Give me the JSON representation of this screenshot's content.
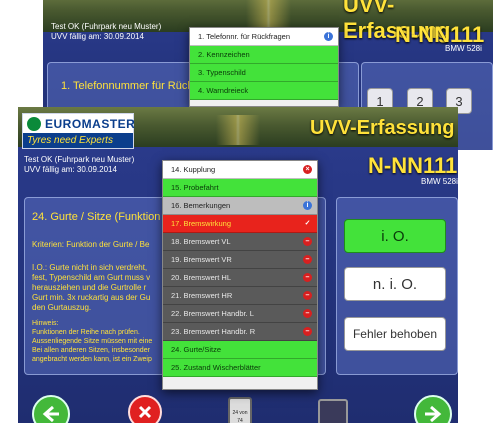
{
  "back_screen": {
    "brand_name": "EUROMASTER",
    "slogan": "Tyres need Experts",
    "app_title": "UVV-Erfassung",
    "test_name": "Test OK (Fuhrpark neu Muster)",
    "due": "UVV fällig am: 30.09.2014",
    "plate": "N-NN111",
    "car_model": "BMW 528i",
    "question": "1. Telefonnummer für Rück",
    "keypad": [
      "1",
      "2",
      "3"
    ],
    "dropdown": [
      {
        "label": "1. Telefonnr. für Rückfragen",
        "style": "white",
        "icon": "i"
      },
      {
        "label": "2. Kennzeichen",
        "style": "green",
        "icon": ""
      },
      {
        "label": "3. Typenschild",
        "style": "green",
        "icon": ""
      },
      {
        "label": "4. Warndreieck",
        "style": "green",
        "icon": ""
      }
    ]
  },
  "front_screen": {
    "brand_name": "EUROMASTER",
    "slogan": "Tyres need Experts",
    "app_title": "UVV-Erfassung",
    "test_name": "Test OK (Fuhrpark neu Muster)",
    "due": "UVV fällig am: 30.09.2014",
    "plate": "N-NN111",
    "car_model": "BMW 528i",
    "question": "24. Gurte / Sitze (Funktion",
    "criteria": "Kriterien: Funktion der Gurte / Be",
    "io_text": "I.O.: Gurte nicht in sich verdreht, \nfest, Typenschild am Gurt muss v\nherausziehen und die Gurtrolle r\nGurt min. 3x ruckartig aus der Gu\nden Gurtauszug.",
    "hint_text": "Hinweis:\nFunktionen der Reihe nach prüfen.\nAussenliegende Sitze müssen mit eine\nBei allen anderen Sitzen, insbesonder\nangebracht werden kann, ist ein Zweip",
    "btn_io": "i. O.",
    "btn_nio": "n. i. O.",
    "btn_fixed": "Fehler behoben",
    "dropdown": [
      {
        "label": "14. Kupplung",
        "style": "white",
        "icon": "x"
      },
      {
        "label": "15. Probefahrt",
        "style": "green",
        "icon": ""
      },
      {
        "label": "16. Bemerkungen",
        "style": "gray",
        "icon": "i"
      },
      {
        "label": "17. Bremswirkung",
        "style": "red",
        "icon": "check"
      },
      {
        "label": "18. Bremswert VL",
        "style": "dark",
        "icon": "-"
      },
      {
        "label": "19. Bremswert VR",
        "style": "dark",
        "icon": "-"
      },
      {
        "label": "20. Bremswert HL",
        "style": "dark",
        "icon": "-"
      },
      {
        "label": "21. Bremswert HR",
        "style": "dark",
        "icon": "-"
      },
      {
        "label": "22. Bremswert Handbr. L",
        "style": "dark",
        "icon": "-"
      },
      {
        "label": "23. Bremswert Handbr. R",
        "style": "dark",
        "icon": "-"
      },
      {
        "label": "24. Gurte/Sitze",
        "style": "green",
        "icon": ""
      },
      {
        "label": "25. Zustand Wischerblätter",
        "style": "green",
        "icon": ""
      }
    ],
    "center_label": "24 von 74"
  },
  "colors": {
    "yellow": "#ffe23a",
    "green": "#43e23a",
    "red": "#e8231c",
    "navy": "#24347e"
  }
}
